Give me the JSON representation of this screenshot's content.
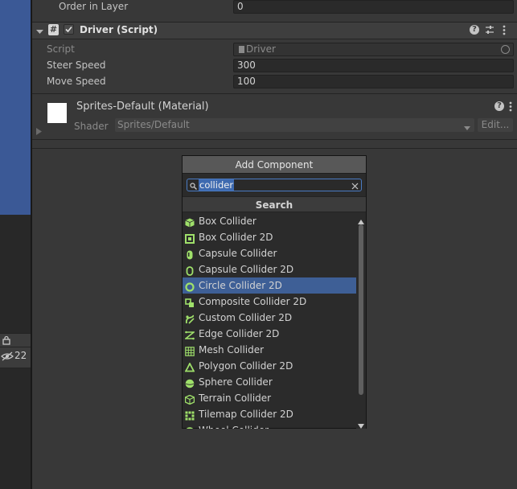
{
  "inspector": {
    "order_in_layer": {
      "label": "Order in Layer",
      "value": "0"
    },
    "driver_component": {
      "title": "Driver (Script)",
      "script": {
        "label": "Script",
        "value": "Driver"
      },
      "steer_speed": {
        "label": "Steer Speed",
        "value": "300"
      },
      "move_speed": {
        "label": "Move Speed",
        "value": "100"
      }
    },
    "material": {
      "title": "Sprites-Default (Material)",
      "shader_label": "Shader",
      "shader_value": "Sprites/Default",
      "edit_label": "Edit..."
    }
  },
  "left_toolbar": {
    "hidden_count": "22"
  },
  "add_component": {
    "button_label": "Add Component",
    "search_value": "collider",
    "section_title": "Search",
    "items": [
      {
        "label": "Box Collider",
        "icon": "box-collider-icon"
      },
      {
        "label": "Box Collider 2D",
        "icon": "box-collider-2d-icon"
      },
      {
        "label": "Capsule Collider",
        "icon": "capsule-collider-icon"
      },
      {
        "label": "Capsule Collider 2D",
        "icon": "capsule-collider-2d-icon"
      },
      {
        "label": "Circle Collider 2D",
        "icon": "circle-collider-2d-icon"
      },
      {
        "label": "Composite Collider 2D",
        "icon": "composite-collider-2d-icon"
      },
      {
        "label": "Custom Collider 2D",
        "icon": "custom-collider-2d-icon"
      },
      {
        "label": "Edge Collider 2D",
        "icon": "edge-collider-2d-icon"
      },
      {
        "label": "Mesh Collider",
        "icon": "mesh-collider-icon"
      },
      {
        "label": "Polygon Collider 2D",
        "icon": "polygon-collider-2d-icon"
      },
      {
        "label": "Sphere Collider",
        "icon": "sphere-collider-icon"
      },
      {
        "label": "Terrain Collider",
        "icon": "terrain-collider-icon"
      },
      {
        "label": "Tilemap Collider 2D",
        "icon": "tilemap-collider-2d-icon"
      },
      {
        "label": "Wheel Collider",
        "icon": "wheel-collider-icon"
      }
    ],
    "selected_index": 4
  },
  "colors": {
    "accent_green": "#9fe06a",
    "selection": "#3e5f96",
    "search_border": "#4a7bc3"
  }
}
